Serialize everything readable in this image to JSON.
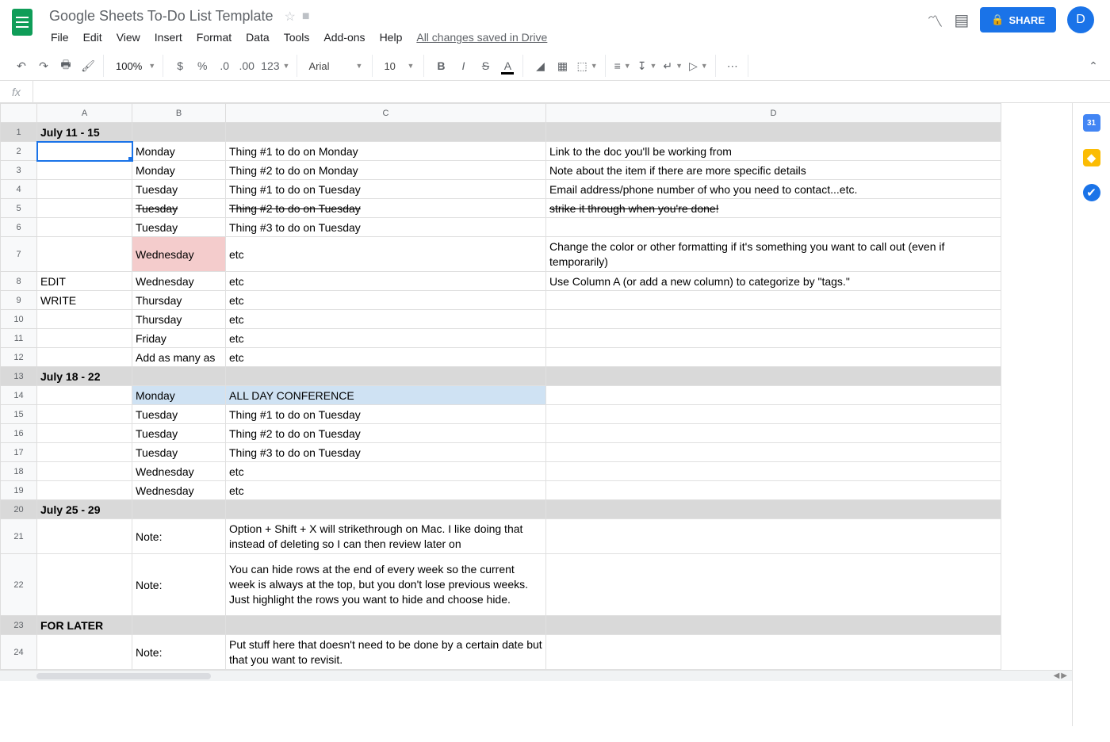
{
  "doc": {
    "title": "Google Sheets To-Do List Template",
    "saveStatus": "All changes saved in Drive"
  },
  "menu": [
    "File",
    "Edit",
    "View",
    "Insert",
    "Format",
    "Data",
    "Tools",
    "Add-ons",
    "Help"
  ],
  "share": {
    "label": "SHARE",
    "avatar": "D"
  },
  "toolbar": {
    "zoom": "100%",
    "font": "Arial",
    "fontSize": "10",
    "numberFormat": "123"
  },
  "sidepanel": {
    "calendar": "31"
  },
  "columns": [
    "A",
    "B",
    "C",
    "D"
  ],
  "rows": [
    {
      "n": 1,
      "cls": "section",
      "A": "July 11 - 15",
      "B": "",
      "C": "",
      "D": ""
    },
    {
      "n": 2,
      "A": "",
      "B": "Monday",
      "C": "Thing #1 to do on Monday",
      "D": "Link to the doc you'll be working from",
      "active": true
    },
    {
      "n": 3,
      "A": "",
      "B": "Monday",
      "C": "Thing #2 to do on Monday",
      "D": "Note about the item if there are more specific details"
    },
    {
      "n": 4,
      "A": "",
      "B": "Tuesday",
      "C": "Thing #1 to do on Tuesday",
      "D": "Email address/phone number of who you need to contact...etc."
    },
    {
      "n": 5,
      "A": "",
      "B": "Tuesday",
      "C": "Thing #2 to do on Tuesday",
      "D": "strike it through when you're done!",
      "strike": true
    },
    {
      "n": 6,
      "A": "",
      "B": "Tuesday",
      "C": "Thing #3 to do on Tuesday",
      "D": ""
    },
    {
      "n": 7,
      "cls": "tall",
      "A": "",
      "B": "Wednesday",
      "C": "etc",
      "D": "Change the color or other formatting if it's something you want to call out (even if temporarily)",
      "pinkB": true,
      "wrapD": true
    },
    {
      "n": 8,
      "A": "EDIT",
      "B": "Wednesday",
      "C": "etc",
      "D": "Use Column A (or add a new column) to categorize by \"tags.\""
    },
    {
      "n": 9,
      "A": "WRITE",
      "B": "Thursday",
      "C": "etc",
      "D": ""
    },
    {
      "n": 10,
      "A": "",
      "B": "Thursday",
      "C": "etc",
      "D": ""
    },
    {
      "n": 11,
      "A": "",
      "B": "Friday",
      "C": "etc",
      "D": ""
    },
    {
      "n": 12,
      "A": "",
      "B": "Add as many as",
      "C": "etc",
      "D": ""
    },
    {
      "n": 13,
      "cls": "section",
      "A": "July 18 - 22",
      "B": "",
      "C": "",
      "D": ""
    },
    {
      "n": 14,
      "A": "",
      "B": "Monday",
      "C": "ALL DAY CONFERENCE",
      "D": "",
      "blueBC": true
    },
    {
      "n": 15,
      "A": "",
      "B": "Tuesday",
      "C": "Thing #1 to do on Tuesday",
      "D": ""
    },
    {
      "n": 16,
      "A": "",
      "B": "Tuesday",
      "C": "Thing #2 to do on Tuesday",
      "D": ""
    },
    {
      "n": 17,
      "A": "",
      "B": "Tuesday",
      "C": "Thing #3 to do on Tuesday",
      "D": ""
    },
    {
      "n": 18,
      "A": "",
      "B": "Wednesday",
      "C": "etc",
      "D": ""
    },
    {
      "n": 19,
      "A": "",
      "B": "Wednesday",
      "C": "etc",
      "D": ""
    },
    {
      "n": 20,
      "cls": "section",
      "A": "July 25 - 29",
      "B": "",
      "C": "",
      "D": ""
    },
    {
      "n": 21,
      "cls": "tall",
      "A": "",
      "B": "Note:",
      "C": "Option + Shift + X will strikethrough on Mac. I like doing that instead of deleting so I can then review later on",
      "D": "",
      "wrapC": true
    },
    {
      "n": 22,
      "cls": "tall3",
      "A": "",
      "B": "Note:",
      "C": "You can hide rows at the end of every week so the current week is always at the top, but you don't lose previous weeks. Just highlight the rows you want to hide and choose hide.",
      "D": "",
      "wrapC": true
    },
    {
      "n": 23,
      "cls": "section",
      "A": "FOR LATER",
      "B": "",
      "C": "",
      "D": ""
    },
    {
      "n": 24,
      "cls": "tall",
      "A": "",
      "B": "Note:",
      "C": "Put stuff here that doesn't need to be done by a certain date but that you want to revisit.",
      "D": "",
      "wrapC": true
    }
  ]
}
